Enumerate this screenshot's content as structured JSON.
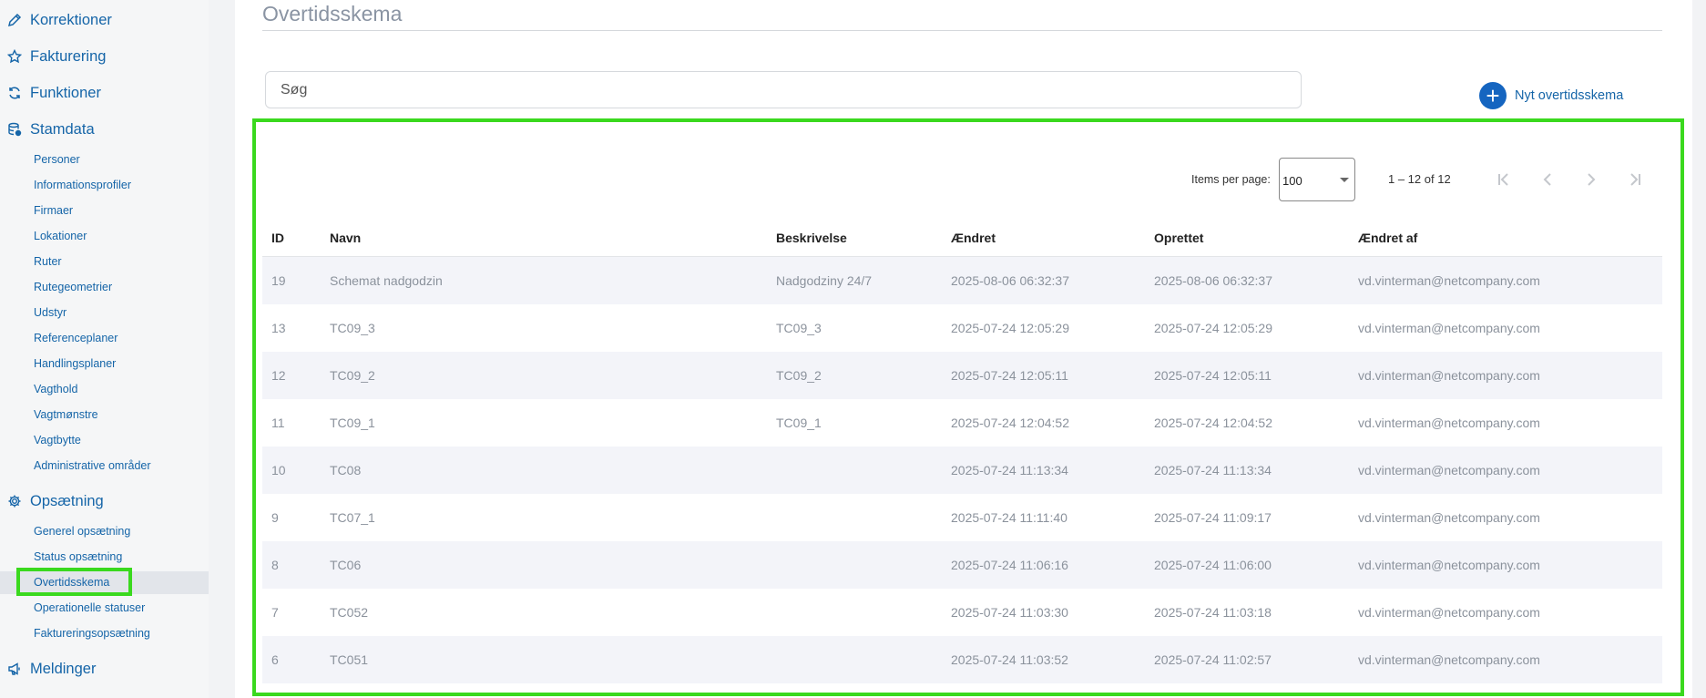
{
  "sidebar": {
    "sections": [
      {
        "label": "Korrektioner",
        "icon": "pencil-icon"
      },
      {
        "label": "Fakturering",
        "icon": "star-icon"
      },
      {
        "label": "Funktioner",
        "icon": "sync-icon"
      },
      {
        "label": "Stamdata",
        "icon": "database-icon"
      },
      {
        "label": "Opsætning",
        "icon": "gear-icon"
      },
      {
        "label": "Meldinger",
        "icon": "megaphone-icon"
      }
    ],
    "stamdata_items": [
      "Personer",
      "Informationsprofiler",
      "Firmaer",
      "Lokationer",
      "Ruter",
      "Rutegeometrier",
      "Udstyr",
      "Referenceplaner",
      "Handlingsplaner",
      "Vagthold",
      "Vagtmønstre",
      "Vagtbytte",
      "Administrative områder"
    ],
    "opsaetning_items": [
      "Generel opsætning",
      "Status opsætning",
      "Overtidsskema",
      "Operationelle statuser",
      "Faktureringsopsætning"
    ],
    "active_item": "Overtidsskema"
  },
  "main": {
    "title": "Overtidsskema",
    "search_placeholder": "Søg",
    "new_button_label": "Nyt overtidsskema",
    "paginator": {
      "items_per_page_label": "Items per page:",
      "items_per_page_value": "100",
      "range_label": "1 – 12 of 12"
    },
    "table": {
      "columns": [
        "ID",
        "Navn",
        "Beskrivelse",
        "Ændret",
        "Oprettet",
        "Ændret af"
      ],
      "rows": [
        [
          "19",
          "Schemat nadgodzin",
          "Nadgodziny 24/7",
          "2025-08-06 06:32:37",
          "2025-08-06 06:32:37",
          "vd.vinterman@netcompany.com"
        ],
        [
          "13",
          "TC09_3",
          "TC09_3",
          "2025-07-24 12:05:29",
          "2025-07-24 12:05:29",
          "vd.vinterman@netcompany.com"
        ],
        [
          "12",
          "TC09_2",
          "TC09_2",
          "2025-07-24 12:05:11",
          "2025-07-24 12:05:11",
          "vd.vinterman@netcompany.com"
        ],
        [
          "11",
          "TC09_1",
          "TC09_1",
          "2025-07-24 12:04:52",
          "2025-07-24 12:04:52",
          "vd.vinterman@netcompany.com"
        ],
        [
          "10",
          "TC08",
          "",
          "2025-07-24 11:13:34",
          "2025-07-24 11:13:34",
          "vd.vinterman@netcompany.com"
        ],
        [
          "9",
          "TC07_1",
          "",
          "2025-07-24 11:11:40",
          "2025-07-24 11:09:17",
          "vd.vinterman@netcompany.com"
        ],
        [
          "8",
          "TC06",
          "",
          "2025-07-24 11:06:16",
          "2025-07-24 11:06:00",
          "vd.vinterman@netcompany.com"
        ],
        [
          "7",
          "TC052",
          "",
          "2025-07-24 11:03:30",
          "2025-07-24 11:03:18",
          "vd.vinterman@netcompany.com"
        ],
        [
          "6",
          "TC051",
          "",
          "2025-07-24 11:03:52",
          "2025-07-24 11:02:57",
          "vd.vinterman@netcompany.com"
        ]
      ]
    }
  },
  "colors": {
    "accent": "#1565c0",
    "link": "#1565a8",
    "highlight": "#3ad91e"
  }
}
